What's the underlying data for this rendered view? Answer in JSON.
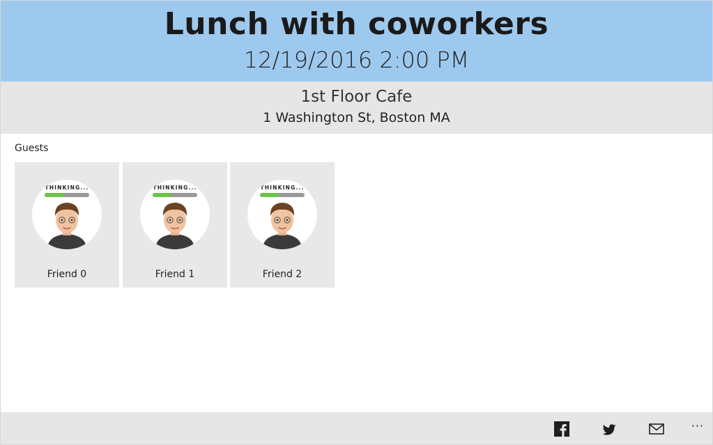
{
  "event": {
    "title": "Lunch with coworkers",
    "datetime": "12/19/2016 2:00 PM"
  },
  "location": {
    "venue": "1st Floor Cafe",
    "address": "1 Washington St, Boston MA"
  },
  "guests": {
    "label": "Guests",
    "items": [
      {
        "name": "Friend 0",
        "avatar_caption": "THINKING..."
      },
      {
        "name": "Friend 1",
        "avatar_caption": "THINKING..."
      },
      {
        "name": "Friend 2",
        "avatar_caption": "THINKING..."
      }
    ]
  },
  "appbar": {
    "buttons": [
      {
        "icon": "facebook-icon"
      },
      {
        "icon": "twitter-icon"
      },
      {
        "icon": "mail-icon"
      }
    ],
    "more_label": "···"
  },
  "colors": {
    "header_bg": "#9ec9ee",
    "location_bg": "#e6e6e6",
    "card_bg": "#e8e8e8"
  }
}
